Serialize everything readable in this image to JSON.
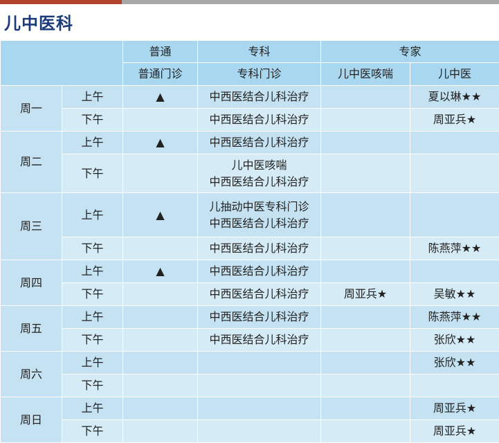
{
  "title": "儿中医科",
  "header": {
    "groups": {
      "putong": "普通",
      "zhuanke": "专科",
      "zhuanjia": "专家"
    },
    "subs": {
      "putong_menzhen": "普通门诊",
      "zhuanke_menzhen": "专科门诊",
      "kesou": "儿中医咳喘",
      "erzhongyi": "儿中医"
    }
  },
  "days": [
    {
      "name": "周一",
      "rows": [
        {
          "ampm": "上午",
          "putong": "▲",
          "zhuanke": [
            "中西医结合儿科治疗"
          ],
          "kesou": "",
          "erzhongyi": "夏以琳★★"
        },
        {
          "ampm": "下午",
          "putong": "",
          "zhuanke": [
            "中西医结合儿科治疗"
          ],
          "kesou": "",
          "erzhongyi": "周亚兵★"
        }
      ]
    },
    {
      "name": "周二",
      "rows": [
        {
          "ampm": "上午",
          "putong": "▲",
          "zhuanke": [
            "中西医结合儿科治疗"
          ],
          "kesou": "",
          "erzhongyi": ""
        },
        {
          "ampm": "下午",
          "putong": "",
          "zhuanke": [
            "儿中医咳喘",
            "中西医结合儿科治疗"
          ],
          "kesou": "",
          "erzhongyi": ""
        }
      ]
    },
    {
      "name": "周三",
      "rows": [
        {
          "ampm": "上午",
          "putong": "▲",
          "zhuanke": [
            "儿抽动中医专科门诊",
            "中西医结合儿科治疗"
          ],
          "kesou": "",
          "erzhongyi": ""
        },
        {
          "ampm": "下午",
          "putong": "",
          "zhuanke": [
            "中西医结合儿科治疗"
          ],
          "kesou": "",
          "erzhongyi": "陈燕萍★★"
        }
      ]
    },
    {
      "name": "周四",
      "rows": [
        {
          "ampm": "上午",
          "putong": "▲",
          "zhuanke": [
            "中西医结合儿科治疗"
          ],
          "kesou": "",
          "erzhongyi": ""
        },
        {
          "ampm": "下午",
          "putong": "",
          "zhuanke": [
            "中西医结合儿科治疗"
          ],
          "kesou": "周亚兵★",
          "erzhongyi": "吴敏★★"
        }
      ]
    },
    {
      "name": "周五",
      "rows": [
        {
          "ampm": "上午",
          "putong": "",
          "zhuanke": [
            "中西医结合儿科治疗"
          ],
          "kesou": "",
          "erzhongyi": "陈燕萍★★"
        },
        {
          "ampm": "下午",
          "putong": "",
          "zhuanke": [
            "中西医结合儿科治疗"
          ],
          "kesou": "",
          "erzhongyi": "张欣★★"
        }
      ]
    },
    {
      "name": "周六",
      "rows": [
        {
          "ampm": "上午",
          "putong": "",
          "zhuanke": [],
          "kesou": "",
          "erzhongyi": "张欣★★"
        },
        {
          "ampm": "下午",
          "putong": "",
          "zhuanke": [],
          "kesou": "",
          "erzhongyi": ""
        }
      ]
    },
    {
      "name": "周日",
      "rows": [
        {
          "ampm": "上午",
          "putong": "",
          "zhuanke": [],
          "kesou": "",
          "erzhongyi": "周亚兵★"
        },
        {
          "ampm": "下午",
          "putong": "",
          "zhuanke": [],
          "kesou": "",
          "erzhongyi": "周亚兵★"
        }
      ]
    }
  ]
}
